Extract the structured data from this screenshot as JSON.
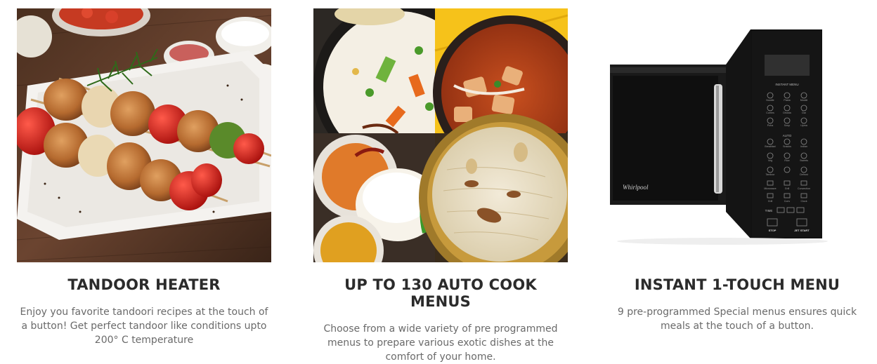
{
  "features": [
    {
      "title": "TANDOOR HEATER",
      "description": "Enjoy you favorite tandoori recipes at the touch of a button! Get perfect tandoor like conditions upto 200° C temperature",
      "image_alt": "Grilled chicken and vegetable skewers on a plate"
    },
    {
      "title": "UP TO 130 AUTO COOK MENUS",
      "description": "Choose from a wide variety of pre programmed menus to prepare various exotic dishes at the comfort of your home.",
      "image_alt": "Collage of Indian dishes: pulao, curry, idli, kheer"
    },
    {
      "title": "INSTANT 1-TOUCH MENU",
      "description": "9 pre-programmed Special menus ensures quick meals at the touch of a button.",
      "image_alt": "Black microwave oven with door open showing touch control panel"
    }
  ],
  "microwave_panel": {
    "brand": "Whirlpool",
    "section_instant": "INSTANT MENU",
    "section_auto": "AUTO",
    "time_label": "TIME",
    "stop_label": "STOP",
    "start_label": "JET START",
    "row1": [
      "Noodle",
      "Pasta",
      "Mocktl"
    ],
    "row2": [
      "Curries",
      "Dhokla",
      "Dal"
    ],
    "row3": [
      "Poha",
      "Soup",
      "Upma"
    ],
    "row4": [
      "Breakfast",
      "Snacks",
      "Indian"
    ],
    "row5": [
      "Veg",
      "Rice",
      "Sweets"
    ],
    "row6": [
      "Tandoor",
      "",
      "Defrost"
    ],
    "row7": [
      "Microwave",
      "Grill",
      "Convection"
    ],
    "row8": [
      "Grill",
      "Conv",
      "Clock"
    ]
  }
}
